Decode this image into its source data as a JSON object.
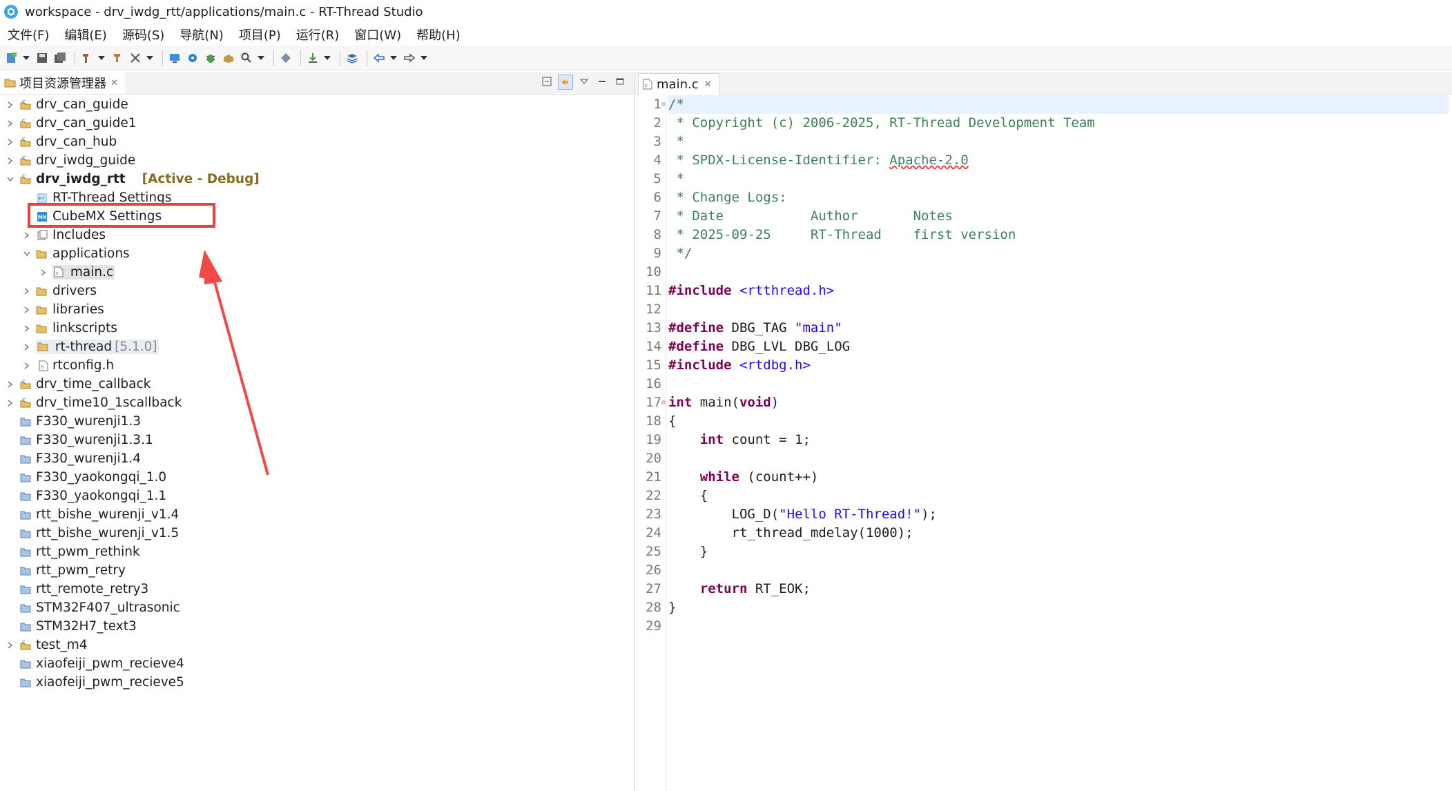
{
  "window": {
    "title": "workspace - drv_iwdg_rtt/applications/main.c - RT-Thread Studio"
  },
  "menu": [
    "文件(F)",
    "编辑(E)",
    "源码(S)",
    "导航(N)",
    "项目(P)",
    "运行(R)",
    "窗口(W)",
    "帮助(H)"
  ],
  "explorer": {
    "tab_label": "项目资源管理器",
    "items": [
      {
        "label": "drv_can_guide"
      },
      {
        "label": "drv_can_guide1"
      },
      {
        "label": "drv_can_hub"
      },
      {
        "label": "drv_iwdg_guide"
      },
      {
        "label": "drv_iwdg_rtt",
        "tag": "[Active - Debug]"
      },
      {
        "label": "RT-Thread Settings"
      },
      {
        "label": "CubeMX Settings"
      },
      {
        "label": "Includes"
      },
      {
        "label": "applications"
      },
      {
        "label": "main.c"
      },
      {
        "label": "drivers"
      },
      {
        "label": "libraries"
      },
      {
        "label": "linkscripts"
      },
      {
        "label": "rt-thread",
        "tag": "[5.1.0]"
      },
      {
        "label": "rtconfig.h"
      },
      {
        "label": "drv_time_callback"
      },
      {
        "label": "drv_time10_1scallback"
      },
      {
        "label": "F330_wurenji1.3"
      },
      {
        "label": "F330_wurenji1.3.1"
      },
      {
        "label": "F330_wurenji1.4"
      },
      {
        "label": "F330_yaokongqi_1.0"
      },
      {
        "label": "F330_yaokongqi_1.1"
      },
      {
        "label": "rtt_bishe_wurenji_v1.4"
      },
      {
        "label": "rtt_bishe_wurenji_v1.5"
      },
      {
        "label": "rtt_pwm_rethink"
      },
      {
        "label": "rtt_pwm_retry"
      },
      {
        "label": "rtt_remote_retry3"
      },
      {
        "label": "STM32F407_ultrasonic"
      },
      {
        "label": "STM32H7_text3"
      },
      {
        "label": "test_m4"
      },
      {
        "label": "xiaofeiji_pwm_recieve4"
      },
      {
        "label": "xiaofeiji_pwm_recieve5"
      }
    ]
  },
  "editor": {
    "tab_label": "main.c",
    "line_numbers": [
      "1",
      "2",
      "3",
      "4",
      "5",
      "6",
      "7",
      "8",
      "9",
      "10",
      "11",
      "12",
      "13",
      "14",
      "15",
      "16",
      "17",
      "18",
      "19",
      "20",
      "21",
      "22",
      "23",
      "24",
      "25",
      "26",
      "27",
      "28",
      "29"
    ],
    "code": {
      "l1": "/*",
      "l2": " * Copyright (c) 2006-2025, RT-Thread Development Team",
      "l3": " *",
      "l4a": " * SPDX-License-Identifier: ",
      "l4b": "Apache-2.0",
      "l5": " *",
      "l6": " * Change Logs:",
      "l7": " * Date           Author       Notes",
      "l8": " * 2025-09-25     RT-Thread    first version",
      "l9": " */",
      "l11a": "#include",
      "l11b": " <rtthread.h>",
      "l13a": "#define",
      "l13b": " DBG_TAG ",
      "l13c": "\"main\"",
      "l14a": "#define",
      "l14b": " DBG_LVL DBG_LOG",
      "l15a": "#include",
      "l15b": " <rtdbg.h>",
      "l17a": "int",
      "l17b": " main(",
      "l17c": "void",
      "l17d": ")",
      "l18": "{",
      "l19a": "    ",
      "l19b": "int",
      "l19c": " count = 1;",
      "l21a": "    ",
      "l21b": "while",
      "l21c": " (count++)",
      "l22": "    {",
      "l23a": "        LOG_D(",
      "l23b": "\"Hello RT-Thread!\"",
      "l23c": ");",
      "l24": "        rt_thread_mdelay(1000);",
      "l25": "    }",
      "l27a": "    ",
      "l27b": "return",
      "l27c": " RT_EOK;",
      "l28": "}"
    }
  }
}
